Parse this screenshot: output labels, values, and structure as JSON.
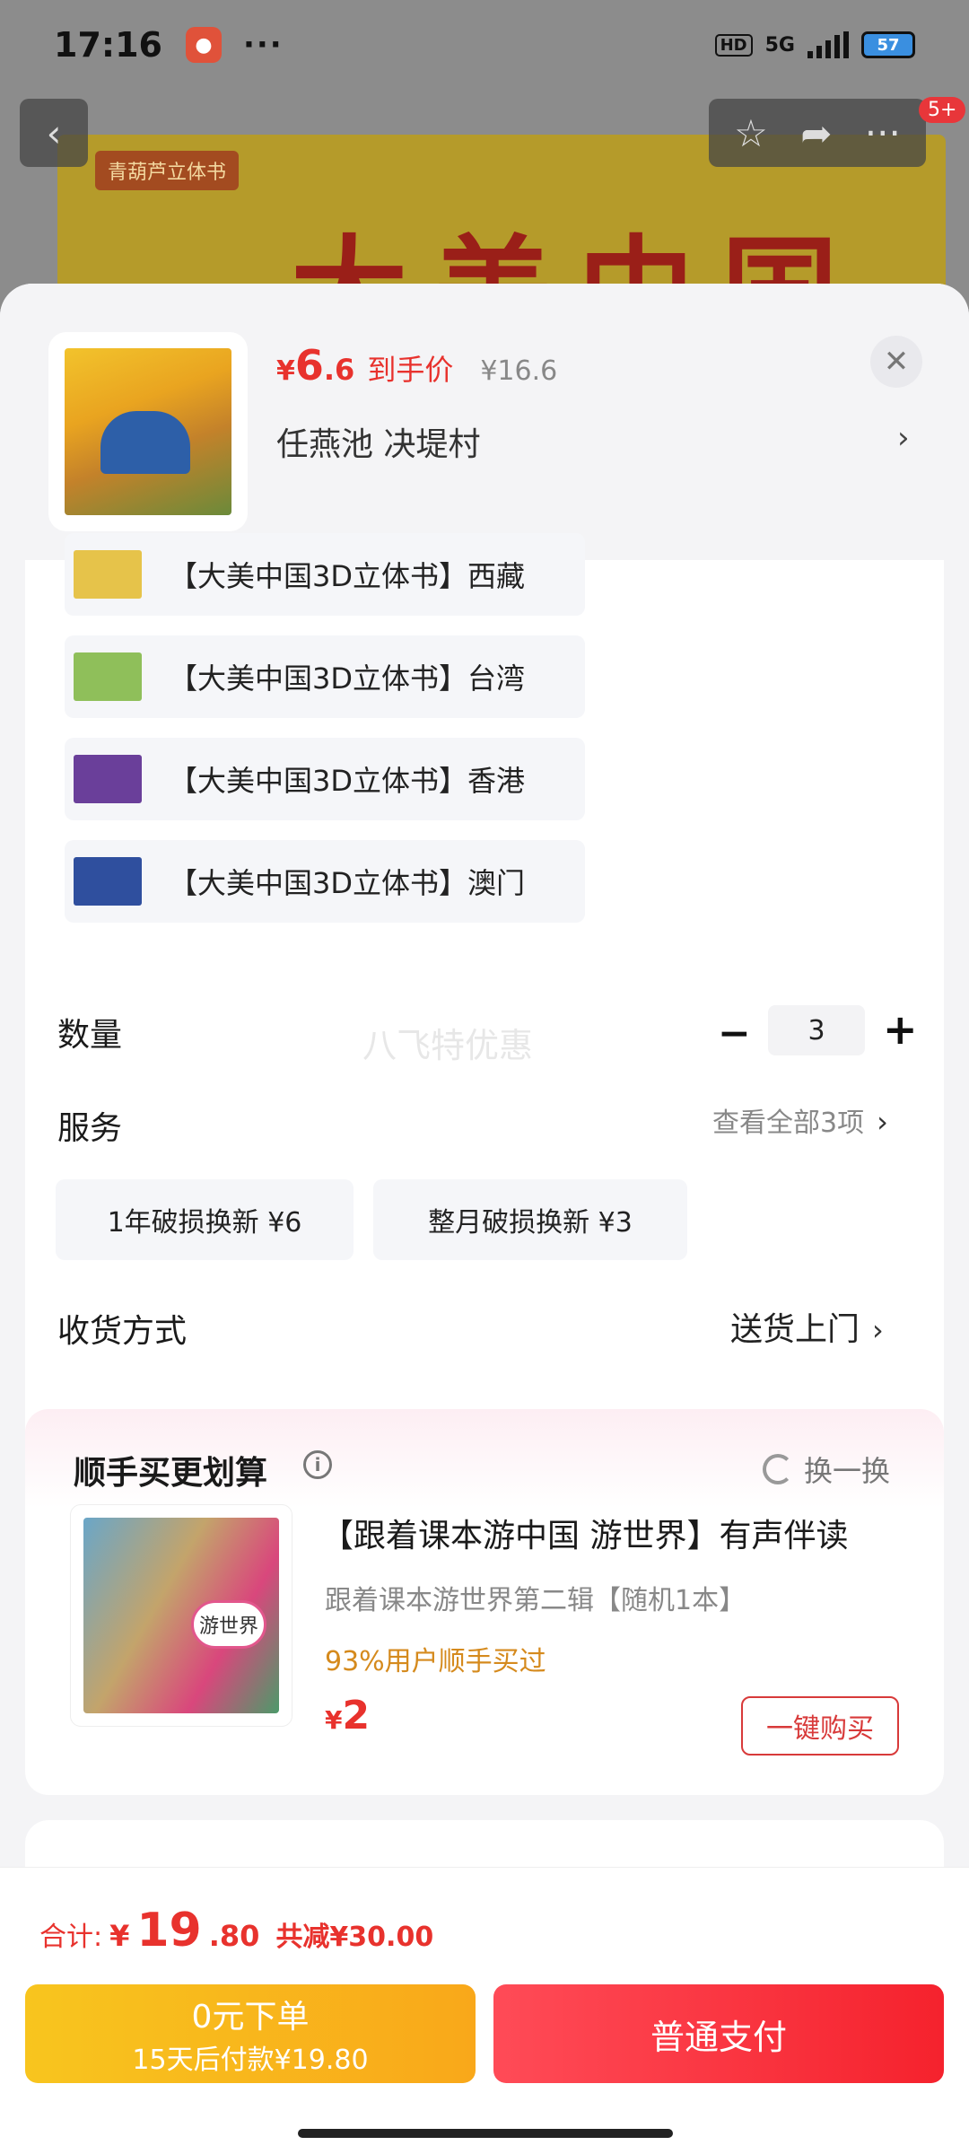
{
  "status_bar": {
    "time": "17:16",
    "dots": "···",
    "hd": "HD",
    "network": "5G",
    "battery": "57"
  },
  "background_page": {
    "banner_tag": "青葫芦立体书",
    "banner_title": "大美中国",
    "notif_count": "5+"
  },
  "sheet": {
    "product": {
      "price_yen": "¥",
      "price_int": "6",
      "price_dec": ".6",
      "price_label": "到手价",
      "original_price": "¥16.6",
      "address": "任燕池  决堤村"
    },
    "variants": [
      {
        "label": "【大美中国3D立体书】西藏",
        "color": "#e6c34a"
      },
      {
        "label": "【大美中国3D立体书】台湾",
        "color": "#8fbf5a"
      },
      {
        "label": "【大美中国3D立体书】香港",
        "color": "#6a3f9a"
      },
      {
        "label": "【大美中国3D立体书】澳门",
        "color": "#2f4f9e"
      }
    ],
    "quantity": {
      "label": "数量",
      "minus": "−",
      "value": "3",
      "plus": "+"
    },
    "watermark": "八飞特优惠",
    "service": {
      "label": "服务",
      "link": "查看全部3项",
      "chevron": "›",
      "chips": [
        "1年破损换新  ¥6",
        "整月破损换新  ¥3"
      ]
    },
    "delivery": {
      "label": "收货方式",
      "value": "送货上门",
      "chevron": "›"
    }
  },
  "upsell": {
    "title": "顺手买更划算",
    "info": "i",
    "refresh": "换一换",
    "product_name": "【跟着课本游中国 游世界】有声伴读",
    "sub": "跟着课本游世界第二辑【随机1本】",
    "percent": "93%用户顺手买过",
    "price_yen": "¥",
    "price": "2",
    "button": "一键购买"
  },
  "bottom": {
    "total_label": "合计:",
    "total_yen": "¥",
    "total_int": "19",
    "total_dec": ".80",
    "total_save": "共减¥30.00",
    "pay_later_main": "0元下单",
    "pay_later_sub": "15天后付款¥19.80",
    "pay_now": "普通支付"
  },
  "colors": {
    "price_red": "#e8322d",
    "pay_later": "#f8c51e",
    "pay_now": "#f5222d",
    "accent_orange": "#d58a1d"
  }
}
